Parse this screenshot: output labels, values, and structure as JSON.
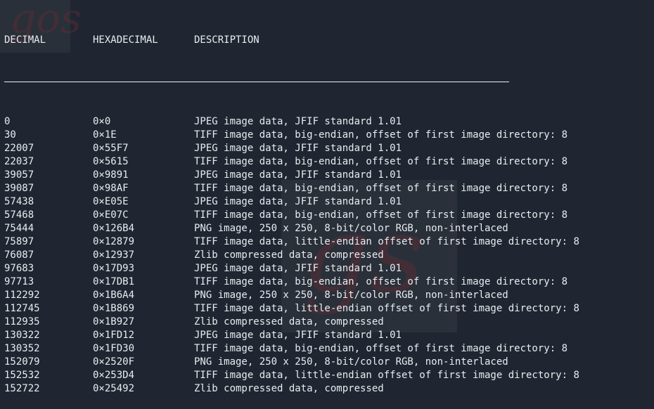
{
  "headers": {
    "decimal": "DECIMAL",
    "hexadecimal": "HEXADECIMAL",
    "description": "DESCRIPTION"
  },
  "rows": [
    {
      "dec": "0",
      "hex": "0×0",
      "desc": "JPEG image data, JFIF standard 1.01"
    },
    {
      "dec": "30",
      "hex": "0×1E",
      "desc": "TIFF image data, big-endian, offset of first image directory: 8"
    },
    {
      "dec": "22007",
      "hex": "0×55F7",
      "desc": "JPEG image data, JFIF standard 1.01"
    },
    {
      "dec": "22037",
      "hex": "0×5615",
      "desc": "TIFF image data, big-endian, offset of first image directory: 8"
    },
    {
      "dec": "39057",
      "hex": "0×9891",
      "desc": "JPEG image data, JFIF standard 1.01"
    },
    {
      "dec": "39087",
      "hex": "0×98AF",
      "desc": "TIFF image data, big-endian, offset of first image directory: 8"
    },
    {
      "dec": "57438",
      "hex": "0×E05E",
      "desc": "JPEG image data, JFIF standard 1.01"
    },
    {
      "dec": "57468",
      "hex": "0×E07C",
      "desc": "TIFF image data, big-endian, offset of first image directory: 8"
    },
    {
      "dec": "75444",
      "hex": "0×126B4",
      "desc": "PNG image, 250 x 250, 8-bit/color RGB, non-interlaced"
    },
    {
      "dec": "75897",
      "hex": "0×12879",
      "desc": "TIFF image data, little-endian offset of first image directory: 8"
    },
    {
      "dec": "76087",
      "hex": "0×12937",
      "desc": "Zlib compressed data, compressed"
    },
    {
      "dec": "97683",
      "hex": "0×17D93",
      "desc": "JPEG image data, JFIF standard 1.01"
    },
    {
      "dec": "97713",
      "hex": "0×17DB1",
      "desc": "TIFF image data, big-endian, offset of first image directory: 8"
    },
    {
      "dec": "112292",
      "hex": "0×1B6A4",
      "desc": "PNG image, 250 x 250, 8-bit/color RGB, non-interlaced"
    },
    {
      "dec": "112745",
      "hex": "0×1B869",
      "desc": "TIFF image data, little-endian offset of first image directory: 8"
    },
    {
      "dec": "112935",
      "hex": "0×1B927",
      "desc": "Zlib compressed data, compressed"
    },
    {
      "dec": "130322",
      "hex": "0×1FD12",
      "desc": "JPEG image data, JFIF standard 1.01"
    },
    {
      "dec": "130352",
      "hex": "0×1FD30",
      "desc": "TIFF image data, big-endian, offset of first image directory: 8"
    },
    {
      "dec": "152079",
      "hex": "0×2520F",
      "desc": "PNG image, 250 x 250, 8-bit/color RGB, non-interlaced"
    },
    {
      "dec": "152532",
      "hex": "0×253D4",
      "desc": "TIFF image data, little-endian offset of first image directory: 8"
    },
    {
      "dec": "152722",
      "hex": "0×25492",
      "desc": "Zlib compressed data, compressed"
    }
  ]
}
